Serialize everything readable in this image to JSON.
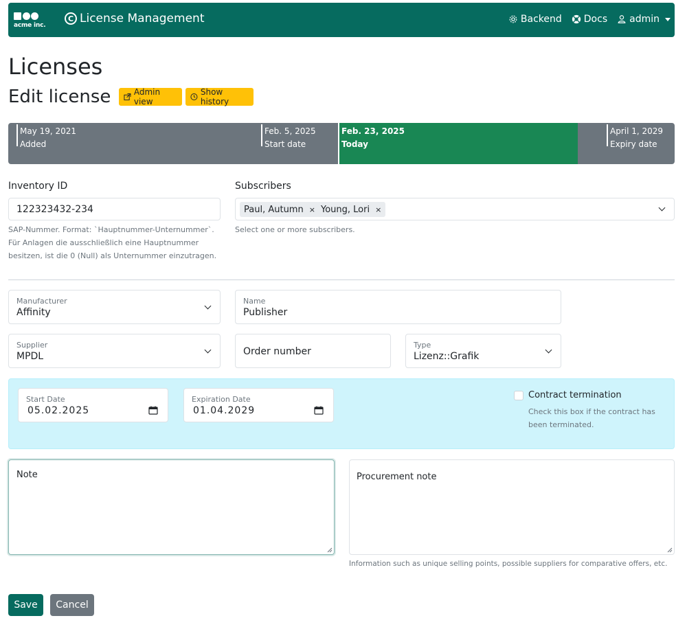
{
  "navbar": {
    "logo_text": "acme inc.",
    "title": "License Management",
    "title_icon": "C",
    "links": [
      {
        "label": "Backend",
        "icon": "gear-icon"
      },
      {
        "label": "Docs",
        "icon": "lifebuoy-icon"
      },
      {
        "label": "admin",
        "icon": "user-icon"
      }
    ]
  },
  "page": {
    "title": "Licenses",
    "subtitle": "Edit license",
    "admin_view_label": "Admin view",
    "show_history_label": "Show history"
  },
  "timeline": {
    "markers": [
      {
        "date": "May 19, 2021",
        "label": "Added"
      },
      {
        "date": "Feb. 5, 2025",
        "label": "Start date"
      },
      {
        "date": "Feb. 23, 2025",
        "label": "Today"
      },
      {
        "date": "April 1, 2029",
        "label": "Expiry date"
      }
    ]
  },
  "form": {
    "inventory": {
      "label": "Inventory ID",
      "value": "122323432-234",
      "help": [
        "SAP-Nummer. Format: `Hauptnummer-Unternummer`.",
        "Für Anlagen die ausschließlich eine Hauptnummer",
        "besitzen, ist die 0 (Null) als Unternummer einzutragen."
      ]
    },
    "subscribers": {
      "label": "Subscribers",
      "chips": [
        "Paul, Autumn",
        "Young, Lori"
      ],
      "remove": "×",
      "help": "Select one or more subscribers."
    },
    "manufacturer": {
      "label": "Manufacturer",
      "value": "Affinity"
    },
    "name": {
      "label": "Name",
      "value": "Publisher"
    },
    "supplier": {
      "label": "Supplier",
      "value": "MPDL"
    },
    "order_number": {
      "label": "Order number"
    },
    "type": {
      "label": "Type",
      "value": "Lizenz::Grafik"
    },
    "start_date": {
      "label": "Start Date",
      "value": "05.02.2025"
    },
    "expiration_date": {
      "label": "Expiration Date",
      "value": "01.04.2029"
    },
    "contract_termination": {
      "label": "Contract termination",
      "help": [
        "Check this box if the contract has",
        "been terminated."
      ]
    },
    "note": {
      "label": "Note"
    },
    "procurement_note": {
      "label": "Procurement note",
      "help": "Information such as unique selling points, possible suppliers for comparative offers, etc."
    }
  },
  "actions": {
    "save": "Save",
    "cancel": "Cancel"
  },
  "colors": {
    "brand": "#066b5f",
    "today": "#198754",
    "timeline": "#6c757d",
    "warning": "#ffc107",
    "info_bg": "#cff4fc"
  }
}
